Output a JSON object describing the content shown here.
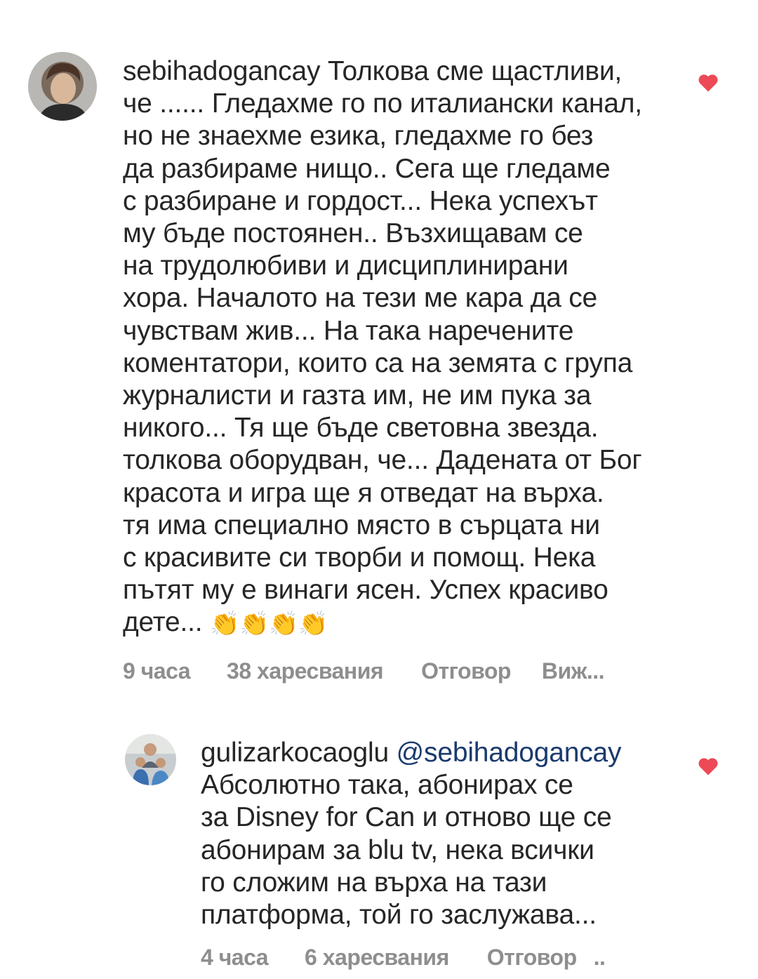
{
  "colors": {
    "heart": "#ed4956",
    "meta_text": "#8e8e8e",
    "body_text": "#262626",
    "mention": "#1a3a6e"
  },
  "comments": [
    {
      "username": "sebihadogancay",
      "text": " Толкова сме щастливи,\nче ...... Гледахме го по италиански канал,\nно не знаехме езика, гледахме го без\nда разбираме нищо.. Сега ще гледаме\nс разбиране и гордост... Нека успехът\nму бъде постоянен.. Възхищавам се\nна трудолюбиви и дисциплинирани\nхора. Началото на тези ме кара да се\nчувствам жив... На така наречените\nкоментатори, които са на земята с група\nжурналисти и газта им, не им пука за\nникого... Тя ще бъде световна звезда.\nтолкова оборудван, че... Дадената от Бог\nкрасота и игра ще я отведат на върха.\nтя има специално място в сърцата ни\nс красивите си творби и помощ. Нека\nпътят му е винаги ясен. Успех красиво\nдете... ",
      "emoji": "👏👏👏👏",
      "time": "9 часа",
      "likes": "38 харесвания",
      "reply": "Отговор",
      "more": "Виж...",
      "liked_icon": "heart-icon"
    },
    {
      "username": "gulizarkocaoglu",
      "mention": "@sebihadogancay",
      "text": "Абсолютно така, абонирах се\nза Disney for Can и отново ще се\nабонирам за blu tv, нека всички\nго сложим на върха на тази\nплатформа, той го заслужава...",
      "time": "4 часа",
      "likes": "6 харесвания",
      "reply": "Отговор",
      "more": "..",
      "liked_icon": "heart-icon"
    }
  ]
}
